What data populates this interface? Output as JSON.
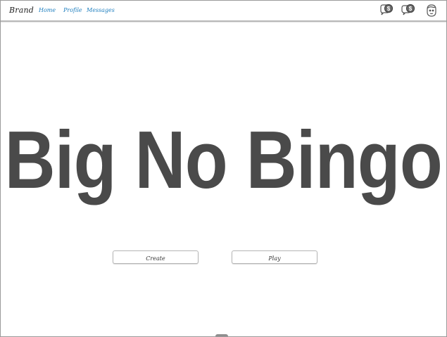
{
  "navbar": {
    "brand": "Brand",
    "links": [
      {
        "label": "Home"
      },
      {
        "label": "Profile"
      },
      {
        "label": "Messages"
      }
    ],
    "icons": [
      "chat-bubble-dollar-icon",
      "chat-bubble-dollar-icon",
      "user-avatar-icon"
    ],
    "link_color": "#1f7fbf"
  },
  "hero": {
    "title": "Big No Bingo",
    "color": "#4a4a4a"
  },
  "actions": {
    "create_label": "Create",
    "play_label": "Play"
  }
}
